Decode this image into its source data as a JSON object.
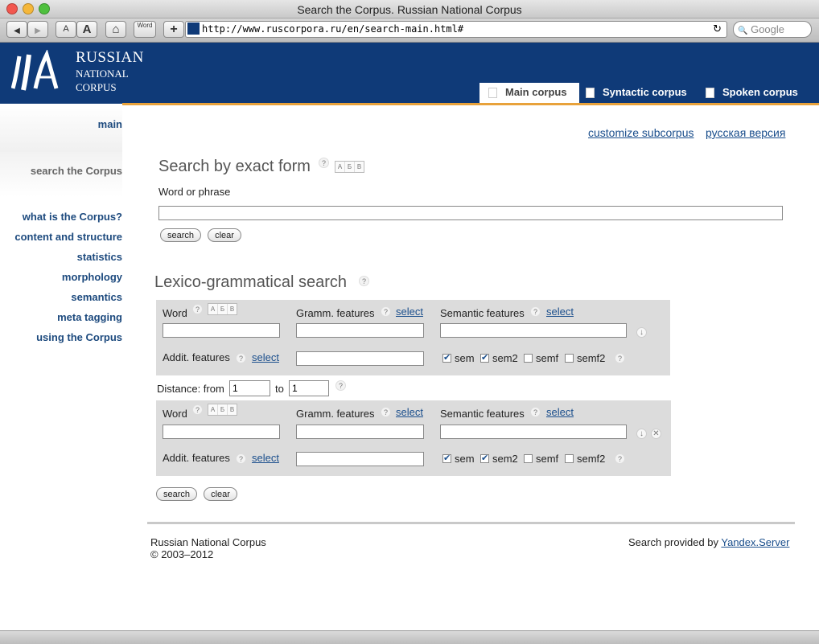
{
  "window": {
    "title": "Search the Corpus. Russian National Corpus",
    "url": "http://www.ruscorpora.ru/en/search-main.html#",
    "search_placeholder": "Google",
    "toolbar": {
      "back": "◀",
      "forward": "▶",
      "font_small": "A",
      "font_large": "A",
      "home": "⌂",
      "word_btn": "Word",
      "add": "+",
      "reload": "↻",
      "google_icon": "🔍"
    }
  },
  "header": {
    "logo_line1": "RUSSIAN",
    "logo_line2": "NATIONAL",
    "logo_line3": "CORPUS",
    "tabs": [
      {
        "label": "Main corpus"
      },
      {
        "label": "Syntactic corpus"
      },
      {
        "label": "Spoken corpus"
      }
    ]
  },
  "sidebar": {
    "main": "main",
    "search": "search the Corpus",
    "items": [
      {
        "label": "what is the Corpus?"
      },
      {
        "label": "content and structure"
      },
      {
        "label": "statistics"
      },
      {
        "label": "morphology"
      },
      {
        "label": "semantics"
      },
      {
        "label": "meta tagging"
      },
      {
        "label": "using the Corpus"
      }
    ]
  },
  "top_links": {
    "customize": "customize subcorpus",
    "russian": "русская версия"
  },
  "exact": {
    "title": "Search by exact form",
    "word_label": "Word or phrase",
    "value": "",
    "search": "search",
    "clear": "clear"
  },
  "lex": {
    "title": "Lexico-grammatical search",
    "word_label": "Word",
    "gramm_label": "Gramm. features",
    "sem_label": "Semantic features",
    "addit_label": "Addit. features",
    "select": "select",
    "help": "?",
    "abv": [
      "А",
      "Б",
      "В"
    ],
    "checks": [
      {
        "label": "sem",
        "checked": true
      },
      {
        "label": "sem2",
        "checked": true
      },
      {
        "label": "semf",
        "checked": false
      },
      {
        "label": "semf2",
        "checked": false
      }
    ],
    "distance_label": "Distance: from",
    "distance_to": "to",
    "distance_from_value": "1",
    "distance_to_value": "1",
    "search": "search",
    "clear": "clear",
    "down_icon": "↓",
    "close_icon": "✕",
    "check_mark": "✔"
  },
  "footer": {
    "org": "Russian National Corpus",
    "years": "© 2003–2012",
    "provided": "Search provided by ",
    "yandex": "Yandex.Server"
  }
}
